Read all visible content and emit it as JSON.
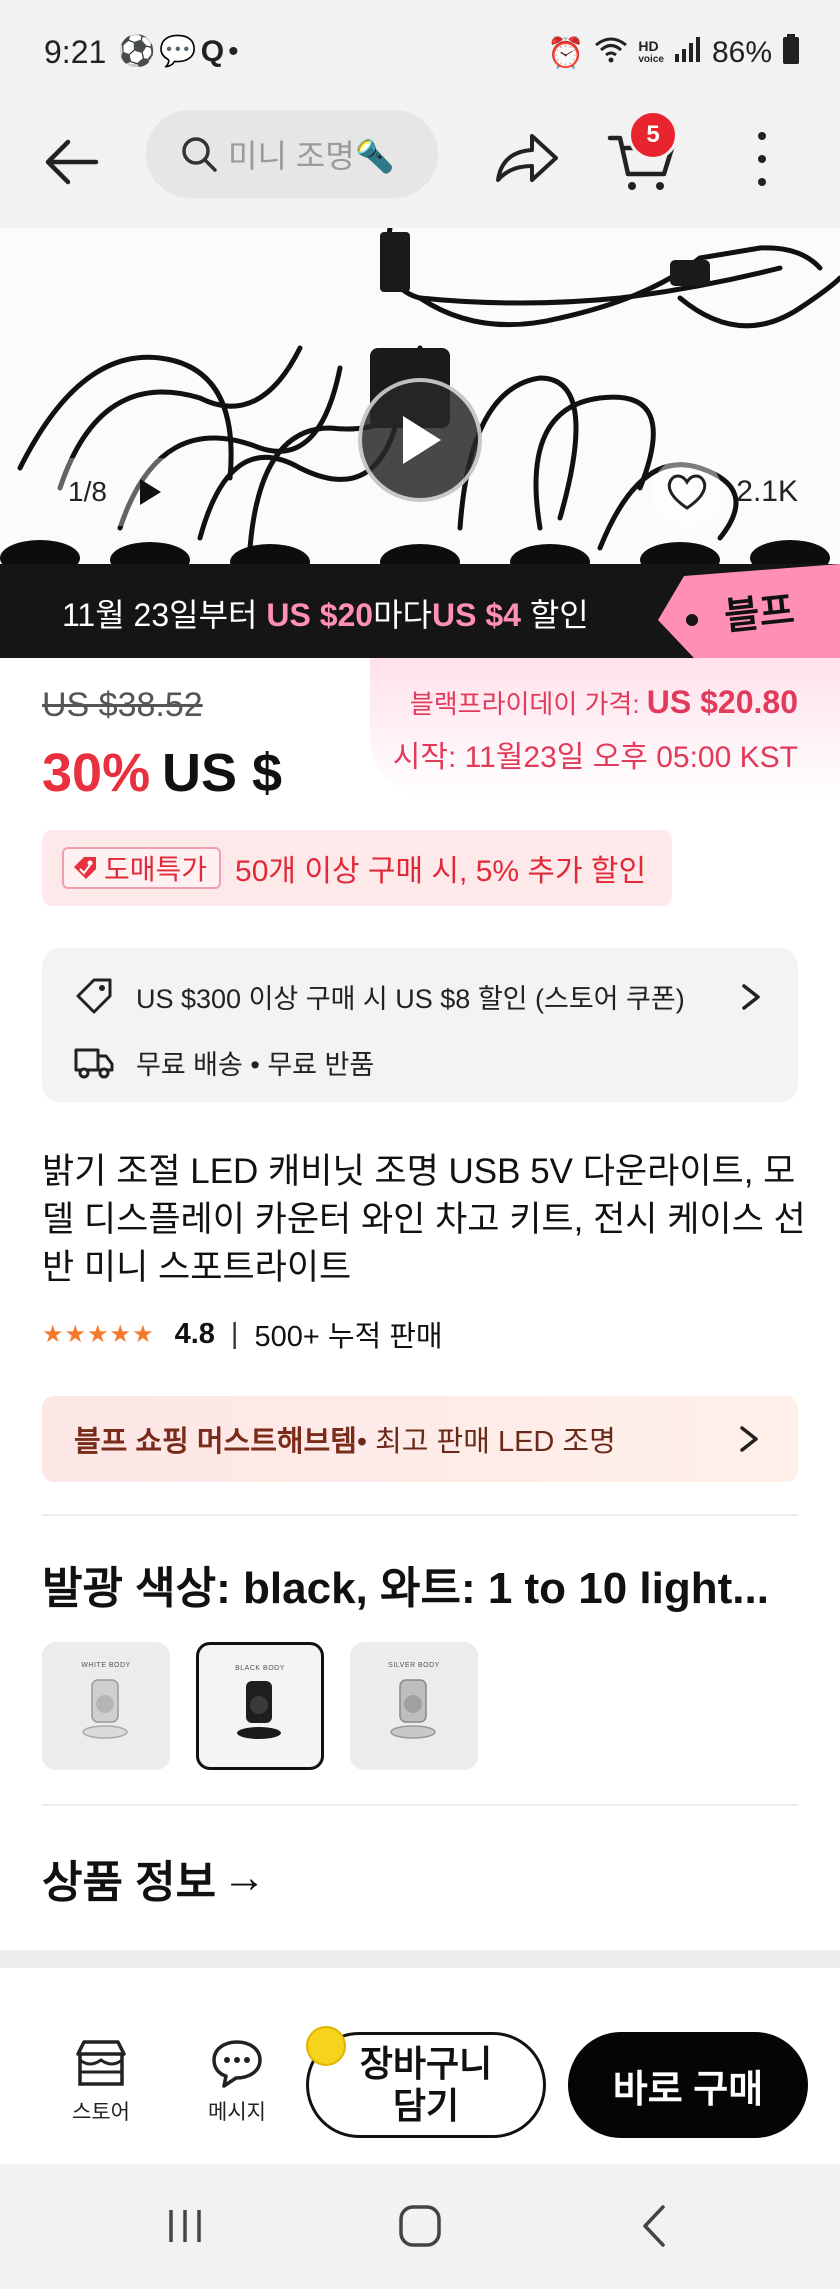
{
  "status_bar": {
    "time": "9:21",
    "left_icons": [
      "soccer-icon",
      "chat-bubbles-icon",
      "q-icon",
      "dot-icon"
    ],
    "battery": "86%",
    "hd_label": "HD",
    "voice_label": "voice"
  },
  "header": {
    "search_placeholder": "미니 조명🔦",
    "cart_count": "5"
  },
  "gallery": {
    "counter": "1/8",
    "likes": "2.1K"
  },
  "promo_banner": {
    "part1": "11월 23일부터 ",
    "amount1": "US $20",
    "part2": "마다",
    "amount2": "US $4",
    "part3": " 할인",
    "tag": "블프"
  },
  "price": {
    "original": "US $38.52",
    "discount": "30%",
    "current": "US $",
    "bf_label": "블랙프라이데이 가격: ",
    "bf_price": "US $20.80",
    "bf_start": "시작: 11월23일 오후 05:00 KST"
  },
  "wholesale": {
    "tag": "도매특가",
    "text": "50개 이상 구매 시, 5% 추가 할인"
  },
  "info": {
    "coupon": "US $300 이상 구매 시 US $8 할인 (스토어 쿠폰)",
    "shipping": "무료 배송 • 무료 반품"
  },
  "product": {
    "title": "밝기 조절 LED 캐비닛 조명 USB 5V 다운라이트, 모델 디스플레이 카운터 와인 차고 키트, 전시 케이스 선반 미니 스포트라이트",
    "rating": "4.8",
    "rating_stars": 4.8,
    "sold": "500+ 누적 판매"
  },
  "must_have": {
    "bold": "블프 쇼핑 머스트해브템",
    "rest": " • 최고 판매 LED 조명"
  },
  "options": {
    "title": "발광 색상: black, 와트: 1 to 10 light...",
    "swatches": [
      {
        "caption": "WHITE BODY",
        "selected": false
      },
      {
        "caption": "BLACK BODY",
        "selected": true
      },
      {
        "caption": "SILVER BODY",
        "selected": false
      }
    ]
  },
  "product_info": {
    "label": "상품 정보",
    "arrow": "→"
  },
  "bottom_bar": {
    "store": "스토어",
    "message": "메시지",
    "add_to_cart": "장바구니 담기",
    "buy_now": "바로 구매"
  },
  "colors": {
    "accent_red": "#e8303f",
    "badge_red": "#e8242e",
    "bf_pink": "#ff8fb3",
    "star_orange": "#f47a2b"
  }
}
